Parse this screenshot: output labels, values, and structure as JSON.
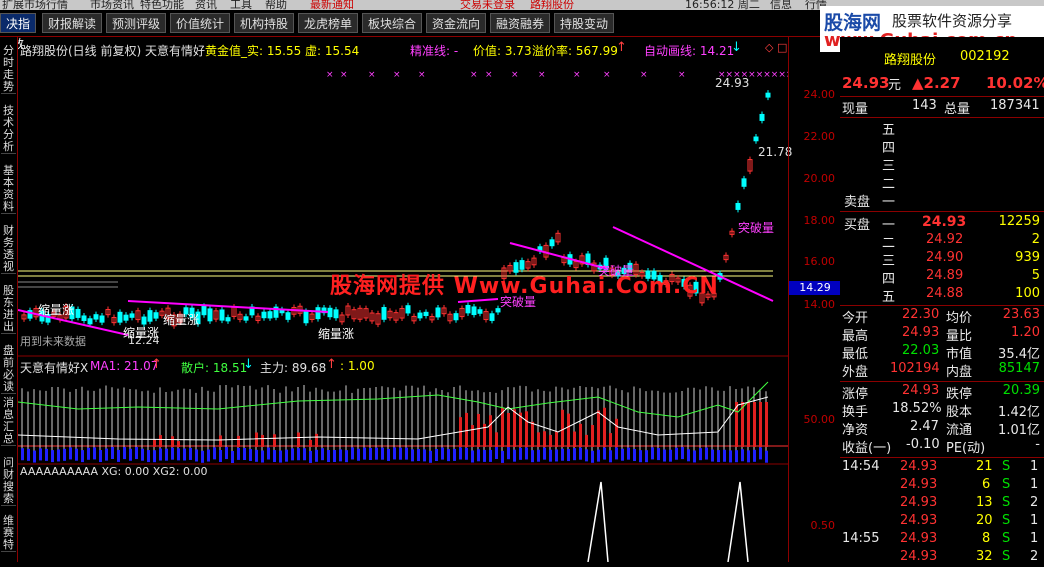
{
  "menubar": {
    "items": [
      "扩展市场行情",
      "市场资讯",
      "特色功能",
      "资讯",
      "工具",
      "帮助",
      "最新通知",
      "交易未登录",
      "路翔股份",
      "16:56:12 周二",
      "信息",
      "行情"
    ]
  },
  "toolbar": {
    "buttons": [
      "决指数",
      "财报解读",
      "预测评级",
      "价值统计",
      "机构持股",
      "龙虎榜单",
      "板块综合",
      "资金流向",
      "融资融券",
      "持股变动"
    ]
  },
  "sidetabs": [
    "分时走势",
    "技术分析",
    "基本资料",
    "财务透视",
    "股东进出",
    "盘前必读",
    "消息汇总",
    "问财搜索",
    "维赛特"
  ],
  "logo": {
    "line1": "股海网",
    "line2": "股票软件资源分享",
    "line3": "www.Guhai.com.cn"
  },
  "chart": {
    "title": "路翔股份(日线 前复权) 天意有情好",
    "info": "黄金值_实: 15.55  虚: 15.54",
    "precision": "精准线: -",
    "price": "价值: 3.73",
    "premium": "溢价率: 567.99",
    "autoline": "自动画线: 14.21",
    "hi_label": "24.93",
    "mid_label": "21.78",
    "lo_label": "12.24",
    "breakthrough": "突破量",
    "shrink": "缩量涨",
    "future_note": "用到未来数据",
    "watermark": "股海网提供 Www.Guhai.Com.CN",
    "sub1_title": "天意有情好X",
    "sub1_ma": "MA1: 21.07",
    "sub1_retail": "散户: 18.51",
    "sub1_main": "主力: 89.68",
    "sub1_extra": ": 1.00",
    "sub2_title": "AAAAAAAAAA XG: 0.00  XG2: 0.00",
    "y_labels": [
      "24.00",
      "22.00",
      "20.00",
      "18.00",
      "16.00",
      "14.00"
    ],
    "cur_price_tag": "14.29",
    "sub1_y": "50.00",
    "sub2_y": "0.50"
  },
  "quote": {
    "name": "路翔股份",
    "code": "002192",
    "price": "24.93",
    "unit": "元",
    "change": "▲2.27",
    "pct": "10.02%",
    "vol_label": "现量",
    "vol": "143",
    "total_label": "总量",
    "total": "187341",
    "sell_labels": [
      "五",
      "四",
      "三",
      "二",
      "一"
    ],
    "sell_side": "卖盘",
    "buy_side": "买盘",
    "buy": [
      {
        "l": "一",
        "p": "24.93",
        "v": "12259"
      },
      {
        "l": "二",
        "p": "24.92",
        "v": "2"
      },
      {
        "l": "三",
        "p": "24.90",
        "v": "939"
      },
      {
        "l": "四",
        "p": "24.89",
        "v": "5"
      },
      {
        "l": "五",
        "p": "24.88",
        "v": "100"
      }
    ],
    "stats": [
      {
        "a": "今开",
        "av": "22.30",
        "b": "均价",
        "bv": "23.63"
      },
      {
        "a": "最高",
        "av": "24.93",
        "b": "量比",
        "bv": "1.20"
      },
      {
        "a": "最低",
        "av": "22.03",
        "b": "市值",
        "bv": "35.4亿"
      },
      {
        "a": "外盘",
        "av": "102194",
        "b": "内盘",
        "bv": "85147"
      },
      {
        "a": "涨停",
        "av": "24.93",
        "b": "跌停",
        "bv": "20.39"
      },
      {
        "a": "换手",
        "av": "18.52%",
        "b": "股本",
        "bv": "1.42亿"
      },
      {
        "a": "净资",
        "av": "2.47",
        "b": "流通",
        "bv": "1.01亿"
      },
      {
        "a": "收益(一)",
        "av": "-0.10",
        "b": "PE(动)",
        "bv": "-"
      }
    ],
    "ticks": [
      {
        "t": "14:54",
        "p": "24.93",
        "v": "21",
        "s": "S",
        "n": "1"
      },
      {
        "t": "",
        "p": "24.93",
        "v": "6",
        "s": "S",
        "n": "1"
      },
      {
        "t": "",
        "p": "24.93",
        "v": "13",
        "s": "S",
        "n": "2"
      },
      {
        "t": "",
        "p": "24.93",
        "v": "20",
        "s": "S",
        "n": "1"
      },
      {
        "t": "14:55",
        "p": "24.93",
        "v": "8",
        "s": "S",
        "n": "1"
      },
      {
        "t": "",
        "p": "24.93",
        "v": "32",
        "s": "S",
        "n": "2"
      }
    ]
  },
  "colors": {
    "up": "#ff3232",
    "down": "#00ffff",
    "ma": "#ff00ff",
    "axis": "#8b0000"
  }
}
